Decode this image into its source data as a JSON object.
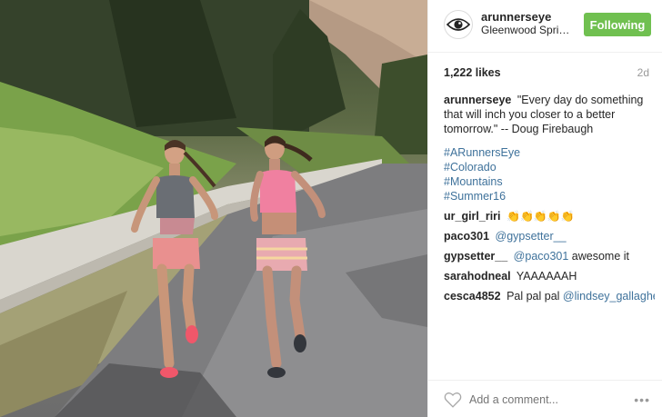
{
  "post": {
    "username": "arunnerseye",
    "location": "Gleenwood Springs",
    "follow_label": "Following",
    "likes": "1,222 likes",
    "age": "2d",
    "caption": {
      "user": "arunnerseye",
      "text": "\"Every day do something that will inch you closer to a better tomorrow.\" -- Doug Firebaugh"
    },
    "hashtags": [
      "#ARunnersEye",
      "#Colorado",
      "#Mountains",
      "#Summer16"
    ],
    "comments": [
      {
        "user": "ur_girl_riri",
        "text": "👏👏👏👏👏",
        "mention": ""
      },
      {
        "user": "paco301",
        "text": "",
        "mention": "@gypsetter__"
      },
      {
        "user": "gypsetter__",
        "mention": "@paco301",
        "text": " awesome it"
      },
      {
        "user": "sarahodneal",
        "text": "YAAAAAAH",
        "mention": ""
      },
      {
        "user": "cesca4852",
        "text": "Pal pal pal ",
        "mention": "@lindsey_gallagher_"
      }
    ],
    "add_comment_placeholder": "Add a comment...",
    "more_label": "•••"
  },
  "colors": {
    "follow_button": "#70c050",
    "link": "#3f729b",
    "muted": "#999999"
  },
  "icons": [
    "eye-logo-icon",
    "heart-icon",
    "more-options-icon"
  ]
}
